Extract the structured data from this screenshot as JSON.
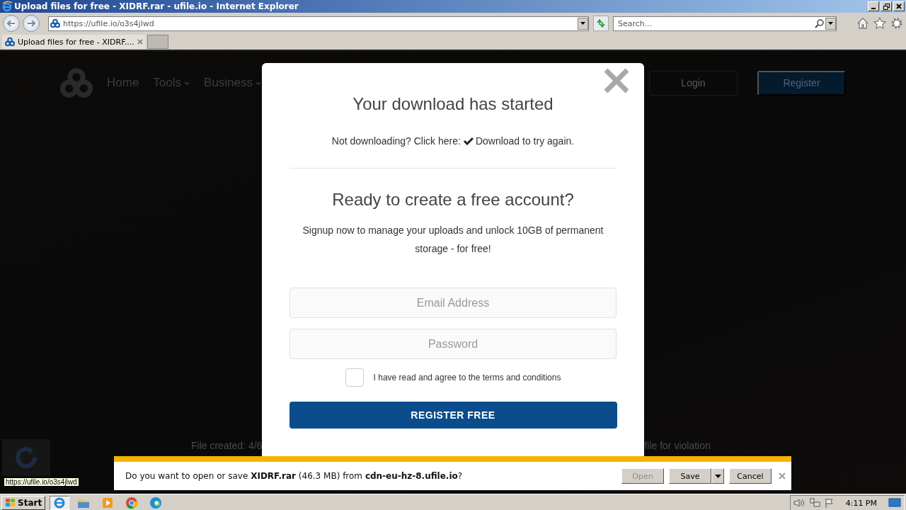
{
  "window": {
    "title": "Upload files for free - XIDRF.rar - ufile.io - Internet Explorer"
  },
  "address_bar": {
    "url": "https://ufile.io/o3s4jlwd"
  },
  "search": {
    "placeholder": "Search..."
  },
  "tabs": [
    {
      "label": "Upload files for free - XIDRF....",
      "selected": true
    }
  ],
  "site_nav": {
    "items": [
      {
        "label": "Home",
        "dropdown": false
      },
      {
        "label": "Tools",
        "dropdown": true
      },
      {
        "label": "Business",
        "dropdown": true
      }
    ],
    "login": "Login",
    "register": "Register"
  },
  "footer": {
    "left": "File created: 4/6",
    "right": "file for violation"
  },
  "modal": {
    "title": "Your download has started",
    "retry_prefix": "Not downloading? Click here:",
    "retry_link": "Download to try again.",
    "signup_title": "Ready to create a free account?",
    "signup_text": "Signup now to manage your uploads and unlock 10GB of permanent storage - for free!",
    "email": {
      "placeholder": "Email Address"
    },
    "password": {
      "placeholder": "Password"
    },
    "terms": {
      "label": "I have read and agree to the terms and conditions",
      "checked": false
    },
    "submit": "REGISTER FREE"
  },
  "download_bar": {
    "message": "Do you want to open or save **XIDRF.rar** (46.3 MB) from **cdn-eu-hz-8.ufile.io**?",
    "buttons": [
      {
        "label": "Open",
        "disabled": true,
        "split": false
      },
      {
        "label": "Save",
        "disabled": false,
        "split": true
      },
      {
        "label": "Cancel",
        "disabled": false,
        "split": false
      }
    ]
  },
  "status_tooltip": "https://ufile.io/o3s4jlwd",
  "taskbar": {
    "start": "Start",
    "apps": [
      {
        "kind": "ie",
        "selected": true
      },
      {
        "kind": "folder",
        "selected": false
      },
      {
        "kind": "media",
        "selected": false
      },
      {
        "kind": "chrome",
        "selected": false
      },
      {
        "kind": "edge",
        "selected": false
      }
    ],
    "clock": "4:11 PM"
  }
}
